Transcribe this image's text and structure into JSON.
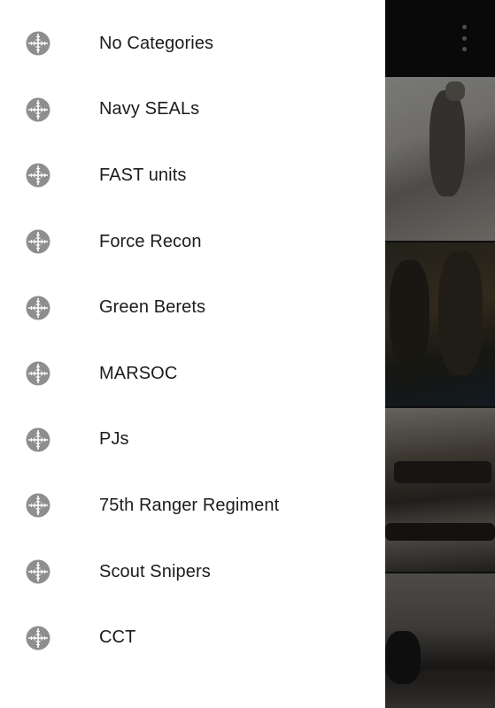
{
  "drawer": {
    "items": [
      {
        "label": "No Categories",
        "icon": "crosshair-icon"
      },
      {
        "label": "Navy SEALs",
        "icon": "crosshair-icon"
      },
      {
        "label": "FAST units",
        "icon": "crosshair-icon"
      },
      {
        "label": "Force Recon",
        "icon": "crosshair-icon"
      },
      {
        "label": "Green Berets",
        "icon": "crosshair-icon"
      },
      {
        "label": "MARSOC",
        "icon": "crosshair-icon"
      },
      {
        "label": "PJs",
        "icon": "crosshair-icon"
      },
      {
        "label": "75th Ranger Regiment",
        "icon": "crosshair-icon"
      },
      {
        "label": "Scout Snipers",
        "icon": "crosshair-icon"
      },
      {
        "label": "CCT",
        "icon": "crosshair-icon"
      }
    ]
  },
  "toolbar": {
    "overflow_icon": "more-vertical-icon"
  },
  "colors": {
    "drawer_bg": "#ffffff",
    "icon": "#8e8e8e",
    "text": "#1c1c1c",
    "toolbar_bg": "#111111"
  }
}
